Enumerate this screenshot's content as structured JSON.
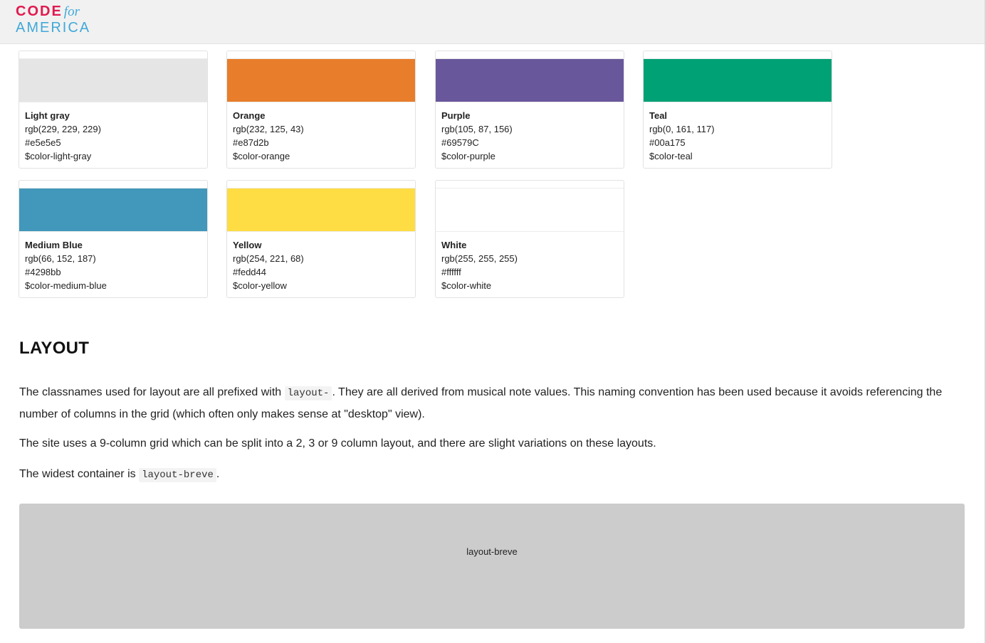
{
  "header": {
    "logo": {
      "code": "CODE",
      "for": "for",
      "america": "AMERICA"
    }
  },
  "swatches": [
    {
      "name": "Light gray",
      "rgb": "rgb(229, 229, 229)",
      "hex": "#e5e5e5",
      "variable": "$color-light-gray",
      "color": "#e5e5e5"
    },
    {
      "name": "Orange",
      "rgb": "rgb(232, 125, 43)",
      "hex": "#e87d2b",
      "variable": "$color-orange",
      "color": "#e87d2b"
    },
    {
      "name": "Purple",
      "rgb": "rgb(105, 87, 156)",
      "hex": "#69579C",
      "variable": "$color-purple",
      "color": "#69579c"
    },
    {
      "name": "Teal",
      "rgb": "rgb(0, 161, 117)",
      "hex": "#00a175",
      "variable": "$color-teal",
      "color": "#00a175"
    },
    {
      "name": "Medium Blue",
      "rgb": "rgb(66, 152, 187)",
      "hex": "#4298bb",
      "variable": "$color-medium-blue",
      "color": "#4298bb"
    },
    {
      "name": "Yellow",
      "rgb": "rgb(254, 221, 68)",
      "hex": "#fedd44",
      "variable": "$color-yellow",
      "color": "#fedd44"
    },
    {
      "name": "White",
      "rgb": "rgb(255, 255, 255)",
      "hex": "#ffffff",
      "variable": "$color-white",
      "color": "#ffffff"
    }
  ],
  "layout_section": {
    "heading": "LAYOUT",
    "para1": {
      "before": "The classnames used for layout are all prefixed with ",
      "code": "layout-",
      "after": ". They are all derived from musical note values. This naming convention has been used because it avoids referencing the number of columns in the grid (which often only makes sense at \"desktop\" view)."
    },
    "para2": "The site uses a 9-column grid which can be split into a 2, 3 or 9 column layout, and there are slight variations on these layouts.",
    "para3": {
      "before": "The widest container is ",
      "code": "layout-breve",
      "after": "."
    },
    "demo_box_label": "layout-breve"
  }
}
